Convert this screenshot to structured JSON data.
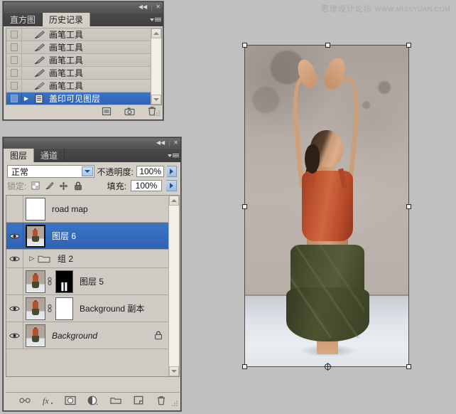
{
  "watermark": {
    "cn": "思缘设计论坛",
    "en": "WWW.MISSYUAN.COM"
  },
  "history_panel": {
    "titlebar": {
      "collapse": "◀◀",
      "separator": "|",
      "close": "✕"
    },
    "tabs": [
      {
        "label": "直方图",
        "active": false
      },
      {
        "label": "历史记录",
        "active": true
      }
    ],
    "menu_icon": "panel-menu-icon",
    "items": [
      {
        "label": "画笔工具",
        "icon": "brush-icon",
        "selected": false,
        "has_arrow": false
      },
      {
        "label": "画笔工具",
        "icon": "brush-icon",
        "selected": false,
        "has_arrow": false
      },
      {
        "label": "画笔工具",
        "icon": "brush-icon",
        "selected": false,
        "has_arrow": false
      },
      {
        "label": "画笔工具",
        "icon": "brush-icon",
        "selected": false,
        "has_arrow": false
      },
      {
        "label": "画笔工具",
        "icon": "brush-icon",
        "selected": false,
        "has_arrow": false
      },
      {
        "label": "盖印可见图层",
        "icon": "stamp-layer-icon",
        "selected": true,
        "has_arrow": true
      }
    ],
    "footer_icons": [
      "new-document-from-state-icon",
      "new-snapshot-icon",
      "delete-icon"
    ]
  },
  "layers_panel": {
    "titlebar": {
      "collapse": "◀◀",
      "separator": "|",
      "close": "✕"
    },
    "tabs": [
      {
        "label": "图层",
        "active": true
      },
      {
        "label": "通道",
        "active": false
      }
    ],
    "menu_icon": "panel-menu-icon",
    "blend_mode": "正常",
    "opacity_label": "不透明度:",
    "opacity_value": "100%",
    "lock_label": "锁定:",
    "lock_icons": [
      "lock-transparency-icon",
      "lock-image-icon",
      "lock-position-icon",
      "lock-all-icon"
    ],
    "fill_label": "填充:",
    "fill_value": "100%",
    "layers": [
      {
        "name": "road map",
        "visible": false,
        "selected": false,
        "type": "normal",
        "thumb": "checker",
        "italic": false,
        "locked": false,
        "mask": null
      },
      {
        "name": "图层 6",
        "visible": true,
        "selected": true,
        "type": "normal",
        "thumb": "dancer",
        "italic": false,
        "locked": false,
        "mask": null
      },
      {
        "name": "组 2",
        "visible": true,
        "selected": false,
        "type": "group",
        "thumb": "folder",
        "italic": false,
        "locked": false,
        "mask": null
      },
      {
        "name": "图层 5",
        "visible": false,
        "selected": false,
        "type": "normal",
        "thumb": "dancer",
        "italic": false,
        "locked": false,
        "mask": "black"
      },
      {
        "name": "Background 副本",
        "visible": true,
        "selected": false,
        "type": "normal",
        "thumb": "dancer",
        "italic": false,
        "locked": false,
        "mask": "white"
      },
      {
        "name": "Background",
        "visible": true,
        "selected": false,
        "type": "normal",
        "thumb": "dancer",
        "italic": true,
        "locked": true,
        "mask": null
      }
    ],
    "footer_icons": [
      "link-layers-icon",
      "layer-style-fx-icon",
      "add-layer-mask-icon",
      "new-adjustment-layer-icon",
      "new-group-icon",
      "new-layer-icon",
      "delete-layer-icon"
    ]
  },
  "canvas": {
    "image_description": "dancer-with-raised-arms",
    "transform_active": true,
    "handles": [
      "top-left",
      "top-center",
      "top-right",
      "middle-left",
      "middle-right",
      "bottom-left",
      "bottom-center",
      "bottom-right"
    ],
    "center_reference_point": "center-reference-icon",
    "colors": {
      "top": "#bf5330",
      "skirt": "#4c5232",
      "wall": "#b5aca5",
      "floor": "#e0e5e9",
      "app_background": "#c0c0c0"
    }
  }
}
